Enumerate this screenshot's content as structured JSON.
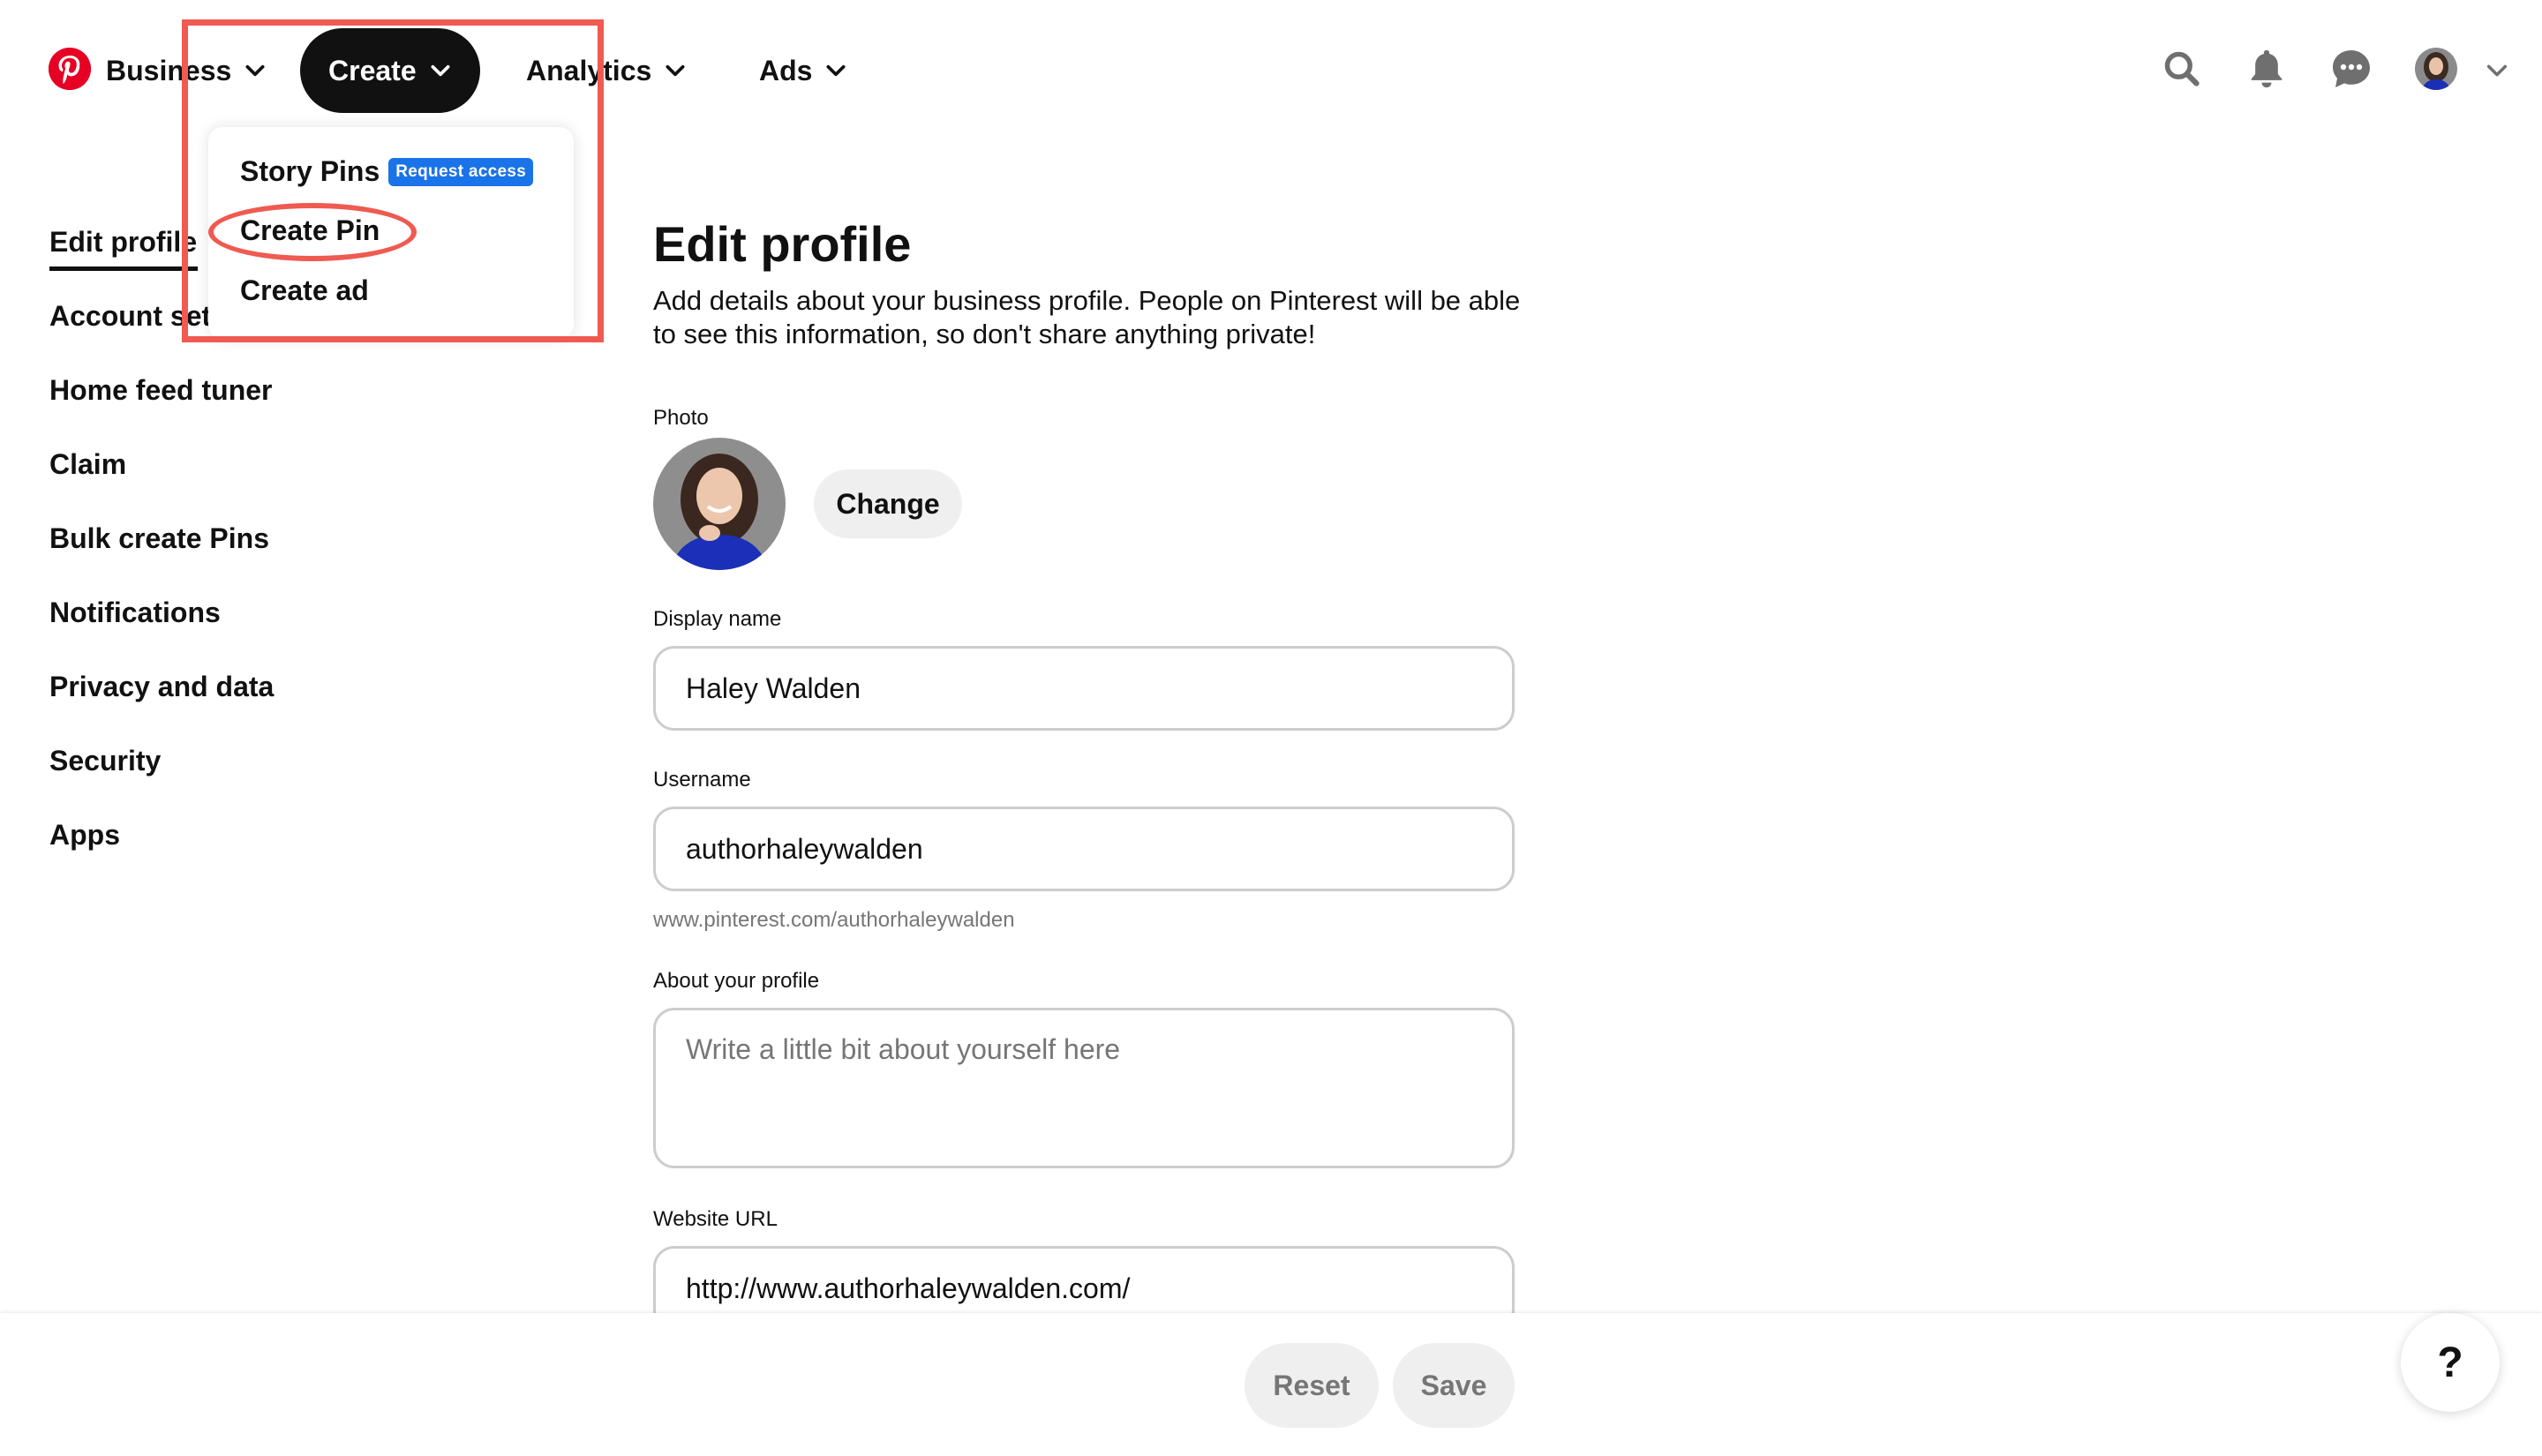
{
  "header": {
    "nav": {
      "business": "Business",
      "create": "Create",
      "analytics": "Analytics",
      "ads": "Ads"
    },
    "icons": [
      "pinterest-logo-icon",
      "search-icon",
      "bell-icon",
      "messages-icon",
      "avatar",
      "chevron-down-icon"
    ]
  },
  "create_menu": {
    "story_pins": "Story Pins",
    "request_access": "Request access",
    "create_pin": "Create Pin",
    "create_ad": "Create ad"
  },
  "sidebar": {
    "items": [
      "Edit profile",
      "Account set",
      "Home feed tuner",
      "Claim",
      "Bulk create Pins",
      "Notifications",
      "Privacy and data",
      "Security",
      "Apps"
    ]
  },
  "main": {
    "title": "Edit profile",
    "description": "Add details about your business profile. People on Pinterest will be able to see this information, so don't share anything private!",
    "photo_label": "Photo",
    "change_label": "Change",
    "display_name_label": "Display name",
    "display_name_value": "Haley Walden",
    "username_label": "Username",
    "username_value": "authorhaleywalden",
    "username_hint": "www.pinterest.com/authorhaleywalden",
    "about_label": "About your profile",
    "about_placeholder": "Write a little bit about yourself here",
    "website_label": "Website URL",
    "website_value": "http://www.authorhaleywalden.com/"
  },
  "footer": {
    "reset_label": "Reset",
    "save_label": "Save",
    "help_label": "?"
  },
  "colors": {
    "brand_red": "#e60023",
    "annotation_red": "#ef5a51",
    "badge_blue": "#1a73e8"
  }
}
